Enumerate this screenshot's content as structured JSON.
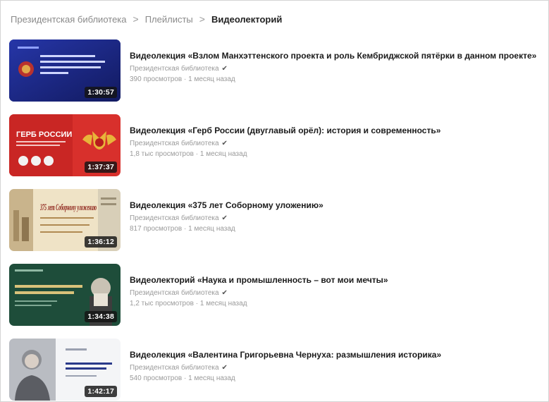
{
  "breadcrumb": {
    "items": [
      "Президентская библиотека",
      "Плейлисты",
      "Видеолекторий"
    ],
    "separator": ">"
  },
  "videos": [
    {
      "title": "Видеолекция «Взлом Манхэттенского проекта и роль Кембриджской пятёрки в данном проекте»",
      "channel": "Президентская библиотека",
      "stats": "390 просмотров · 1 месяц назад",
      "duration": "1:30:57",
      "thumb_icon": "lecture-slide-blue"
    },
    {
      "title": "Видеолекция «Герб России (двуглавый орёл): история и современность»",
      "channel": "Президентская библиотека",
      "stats": "1,8 тыс просмотров · 1 месяц назад",
      "duration": "1:37:37",
      "thumb_icon": "coat-of-arms-red",
      "thumb_text": "ГЕРБ РОССИИ"
    },
    {
      "title": "Видеолекция «375 лет Соборному уложению»",
      "channel": "Президентская библиотека",
      "stats": "817 просмотров · 1 месяц назад",
      "duration": "1:36:12",
      "thumb_icon": "old-manuscript",
      "thumb_text": "375 лет Соборному уложению"
    },
    {
      "title": "Видеолекторий «Наука и промышленность – вот мои мечты»",
      "channel": "Президентская библиотека",
      "stats": "1,2 тыс просмотров · 1 месяц назад",
      "duration": "1:34:38",
      "thumb_icon": "lecture-slide-green"
    },
    {
      "title": "Видеолекция «Валентина Григорьевна Чернуха: размышления историка»",
      "channel": "Президентская библиотека",
      "stats": "540 просмотров · 1 месяц назад",
      "duration": "1:42:17",
      "thumb_icon": "portrait-slide"
    }
  ],
  "colors": {
    "thumb_blue": "#1c2a8a",
    "thumb_red": "#d8302c",
    "thumb_beige": "#efe3c6",
    "thumb_green": "#1e4d3a",
    "title_text": "#1a1a1a",
    "meta_text": "#9a9a9a"
  }
}
